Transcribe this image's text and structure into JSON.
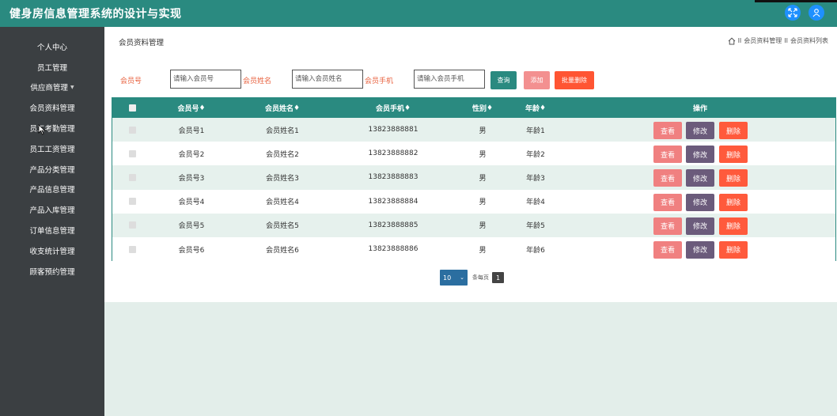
{
  "app": {
    "title": "健身房信息管理系统的设计与实现",
    "colors": {
      "header": "#2a8a80",
      "sidebar": "#3b3f42",
      "view_button": "#f08080",
      "edit_button": "#6b5b7b",
      "delete_button": "#ff5a3c",
      "query_button": "#2a8a80",
      "add_button": "#f39090",
      "batch_delete_button": "#ff5533"
    },
    "top_icons": [
      "fullscreen-icon",
      "user-icon"
    ]
  },
  "sidebar": {
    "items": [
      {
        "label": "个人中心",
        "arrow": false
      },
      {
        "label": "员工管理",
        "arrow": false
      },
      {
        "label": "供应商管理",
        "arrow": true
      },
      {
        "label": "会员资料管理",
        "arrow": false
      },
      {
        "label": "员工考勤管理",
        "arrow": false
      },
      {
        "label": "员工工资管理",
        "arrow": false
      },
      {
        "label": "产品分类管理",
        "arrow": false
      },
      {
        "label": "产品信息管理",
        "arrow": false
      },
      {
        "label": "产品入库管理",
        "arrow": false
      },
      {
        "label": "订单信息管理",
        "arrow": false
      },
      {
        "label": "收支统计管理",
        "arrow": false
      },
      {
        "label": "顾客预约管理",
        "arrow": false
      }
    ]
  },
  "page": {
    "title": "会员资料管理",
    "breadcrumb": [
      "会员资料管理",
      "会员资料列表"
    ],
    "breadcrumb_separator": "II"
  },
  "search": {
    "fields": [
      {
        "label": "会员号",
        "placeholder": "请输入会员号"
      },
      {
        "label": "会员姓名",
        "placeholder": "请输入会员姓名"
      },
      {
        "label": "会员手机",
        "placeholder": "请输入会员手机"
      }
    ],
    "query_label": "查询",
    "add_label": "添加",
    "batch_delete_label": "批量删除"
  },
  "table": {
    "columns": [
      "会员号",
      "会员姓名",
      "会员手机",
      "性别",
      "年龄",
      "操作"
    ],
    "sort_marker": "♦",
    "rows": [
      {
        "id": "会员号1",
        "name": "会员姓名1",
        "phone": "13823888881",
        "gender": "男",
        "age": "年龄1"
      },
      {
        "id": "会员号2",
        "name": "会员姓名2",
        "phone": "13823888882",
        "gender": "男",
        "age": "年龄2"
      },
      {
        "id": "会员号3",
        "name": "会员姓名3",
        "phone": "13823888883",
        "gender": "男",
        "age": "年龄3"
      },
      {
        "id": "会员号4",
        "name": "会员姓名4",
        "phone": "13823888884",
        "gender": "男",
        "age": "年龄4"
      },
      {
        "id": "会员号5",
        "name": "会员姓名5",
        "phone": "13823888885",
        "gender": "男",
        "age": "年龄5"
      },
      {
        "id": "会员号6",
        "name": "会员姓名6",
        "phone": "13823888886",
        "gender": "男",
        "age": "年龄6"
      }
    ],
    "actions": {
      "view": "查看",
      "edit": "修改",
      "delete": "删除"
    }
  },
  "pagination": {
    "page_size": "10",
    "per_page_label": "条每页",
    "current_page": "1"
  }
}
